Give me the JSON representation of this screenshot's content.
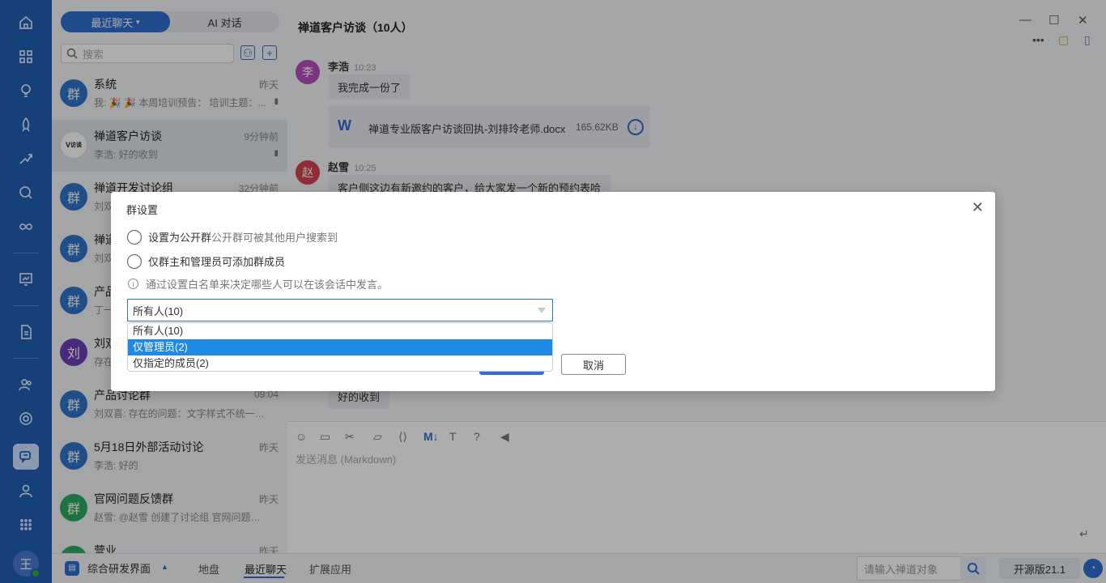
{
  "colors": {
    "rail": "#1f5fb3",
    "accent": "#2f6fd1",
    "selected_option": "#1e8ae6"
  },
  "rail": {
    "icons": [
      "home-icon",
      "grid-icon",
      "bulb-icon",
      "rocket-icon",
      "sprint-icon",
      "search-icon",
      "infinity-icon",
      "dashboard-icon",
      "document-icon",
      "team-icon",
      "settings-icon",
      "chat-icon",
      "user-icon",
      "apps-icon"
    ],
    "avatar": "王"
  },
  "list": {
    "segments": [
      "最近聊天",
      "AI 对话"
    ],
    "search_placeholder": "搜索",
    "conversations": [
      {
        "avatar": "群",
        "name": "系统",
        "time": "昨天",
        "preview": "我: 🎉 🎉 本周培训预告：  培训主题：...",
        "pinned": true
      },
      {
        "avatar": "V",
        "name": "禅道客户访谈",
        "time": "9分钟前",
        "preview": "李浩: 好的收到",
        "pinned": true
      },
      {
        "avatar": "群",
        "name": "禅道开发讨论组",
        "time": "32分钟前",
        "preview": "刘双"
      },
      {
        "avatar": "群",
        "name": "禅道",
        "time": "",
        "preview": "刘双"
      },
      {
        "avatar": "群",
        "name": "产品",
        "time": "",
        "preview": "丁一"
      },
      {
        "avatar": "刘",
        "name": "刘双",
        "time": "",
        "preview": "存在"
      },
      {
        "avatar": "群",
        "name": "产品讨论群",
        "time": "09:04",
        "preview": "刘双喜: 存在的问题：文字样式不统一：..."
      },
      {
        "avatar": "群",
        "name": "5月18日外部活动讨论",
        "time": "昨天",
        "preview": "李浩: 好的"
      },
      {
        "avatar": "群",
        "name": "官网问题反馈群",
        "time": "昨天",
        "preview": "赵雪: @赵雪 创建了讨论组 官网问题反..."
      },
      {
        "avatar": "群",
        "name": "营业",
        "time": "昨天",
        "preview": ""
      }
    ]
  },
  "chat": {
    "title": "禅道客户访谈（10人）",
    "messages": [
      {
        "avatar": "李",
        "name": "李浩",
        "time": "10:23",
        "text": "我完成一份了"
      },
      {
        "avatar": "赵",
        "name": "赵雪",
        "time": "10:25",
        "text": "客户侧这边有新邀约的客户，给大家发一个新的预约表哈"
      }
    ],
    "file": {
      "icon": "W",
      "name": "禅道专业版客户访谈回执-刘排玲老师.docx",
      "size": "165.62KB"
    },
    "last_bubble": "好的收到",
    "editor_placeholder": "发送消息 (Markdown)"
  },
  "bottom": {
    "app": "综合研发界面",
    "tabs": [
      "地盘",
      "最近聊天",
      "扩展应用"
    ],
    "search_placeholder": "请输入禅道对象",
    "version": "开源版21.1"
  },
  "dialog": {
    "title": "群设置",
    "option_public": "设置为公开群",
    "option_public_hint": "公开群可被其他用户搜索到",
    "option_admin": "仅群主和管理员可添加群成员",
    "info": "通过设置白名单来决定哪些人可以在该会话中发言。",
    "select_value": "所有人(10)",
    "options": [
      "所有人(10)",
      "仅管理员(2)",
      "仅指定的成员(2)"
    ],
    "selected_option": "仅管理员(2)",
    "cancel": "取消"
  }
}
